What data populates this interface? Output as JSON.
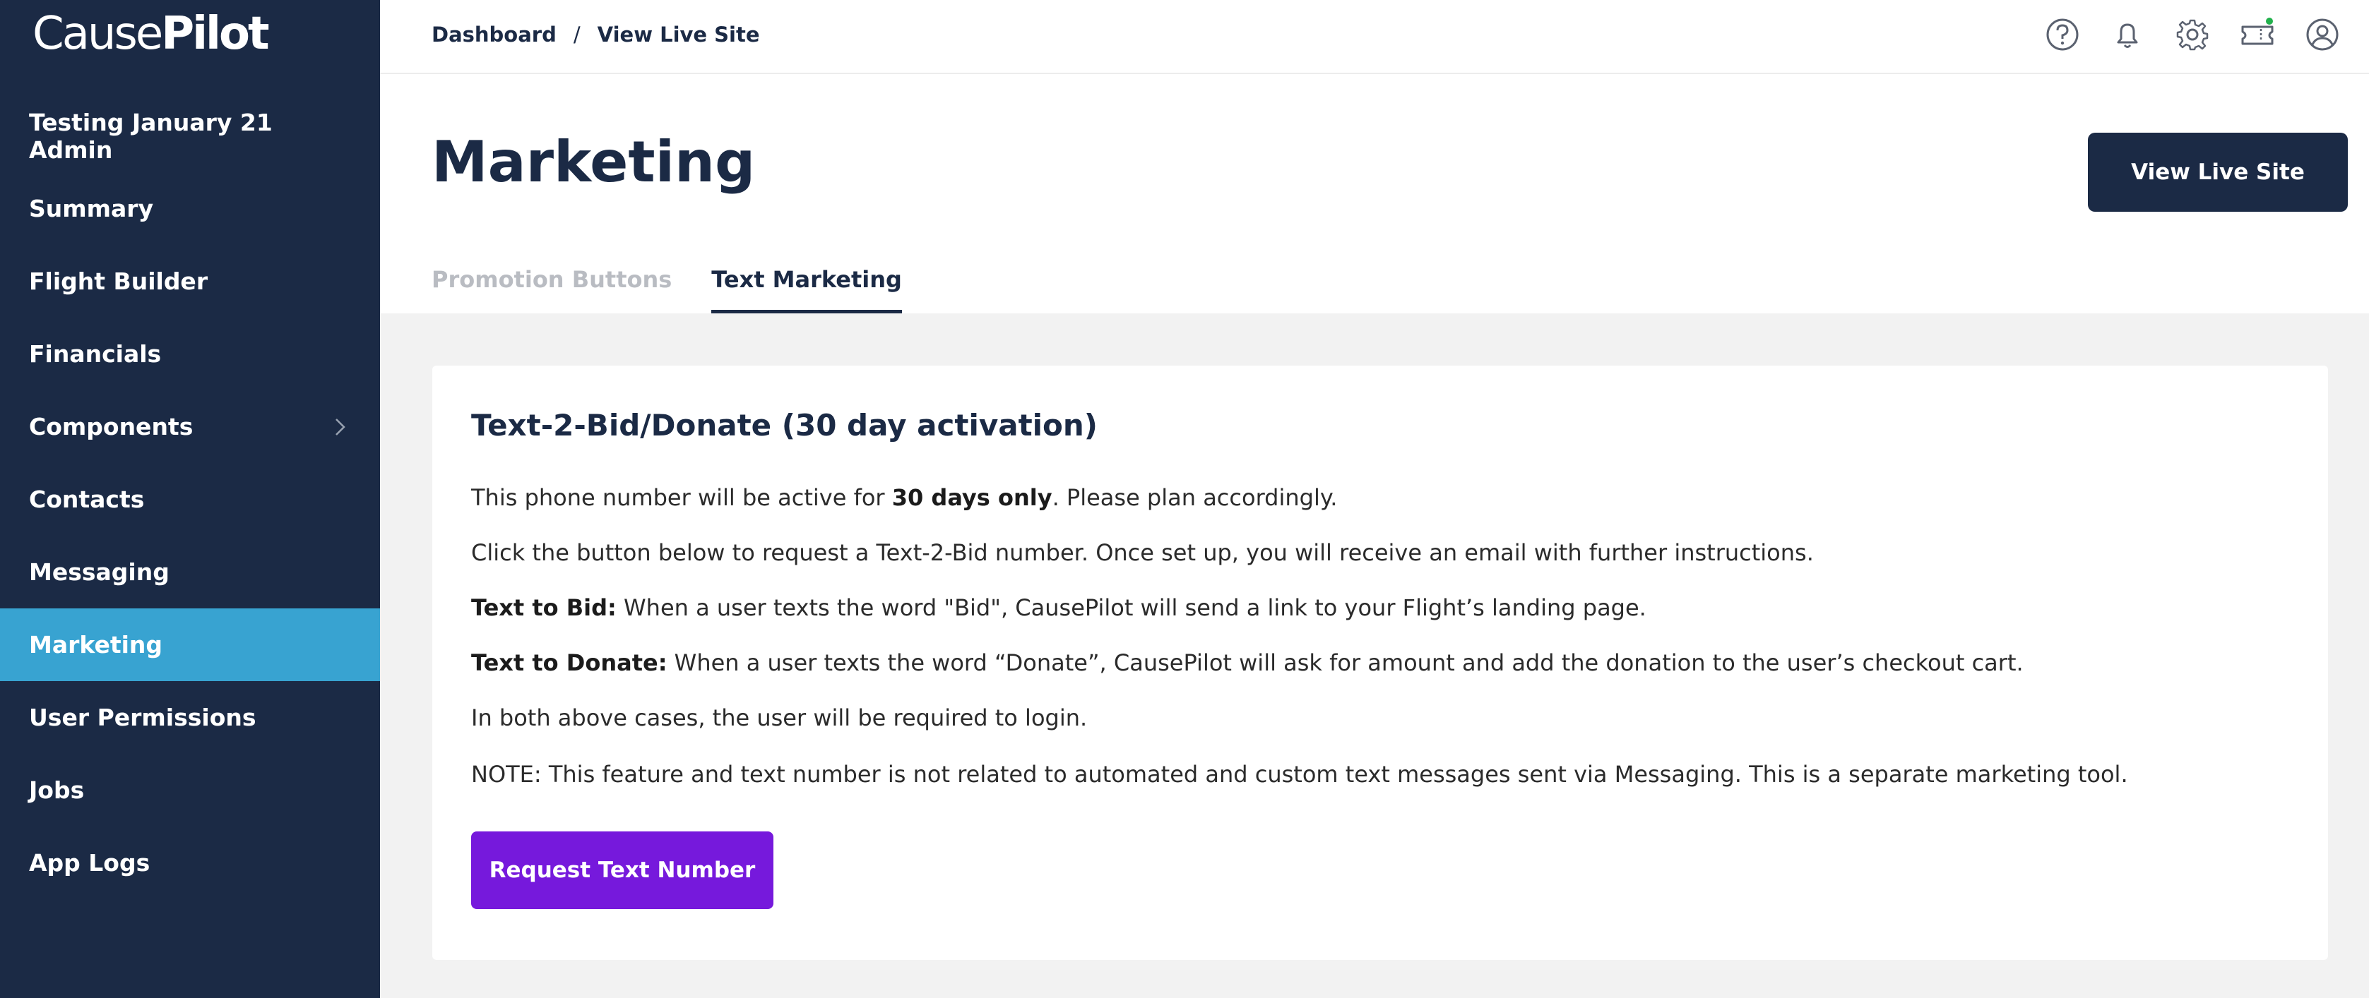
{
  "brand": {
    "logo_part1": "Cause",
    "logo_part2": "Pilot"
  },
  "sidebar": {
    "items": [
      {
        "label": "Testing January 21 Admin",
        "active": false
      },
      {
        "label": "Summary",
        "active": false
      },
      {
        "label": "Flight Builder",
        "active": false
      },
      {
        "label": "Financials",
        "active": false
      },
      {
        "label": "Components",
        "active": false,
        "has_submenu": true
      },
      {
        "label": "Contacts",
        "active": false
      },
      {
        "label": "Messaging",
        "active": false
      },
      {
        "label": "Marketing",
        "active": true
      },
      {
        "label": "User Permissions",
        "active": false
      },
      {
        "label": "Jobs",
        "active": false
      },
      {
        "label": "App Logs",
        "active": false
      }
    ]
  },
  "topbar": {
    "breadcrumb": [
      "Dashboard",
      "View Live Site"
    ],
    "breadcrumb_separator": "/",
    "icons": [
      "help-icon",
      "bell-icon",
      "gear-icon",
      "ticket-icon",
      "user-icon"
    ],
    "notification_dot_color": "#22b14c"
  },
  "header": {
    "title": "Marketing",
    "live_button": "View Live Site",
    "tabs": [
      {
        "label": "Promotion Buttons",
        "active": false
      },
      {
        "label": "Text Marketing",
        "active": true
      }
    ]
  },
  "card": {
    "title": "Text-2-Bid/Donate (30 day activation)",
    "p1_pre": "This phone number will be active for ",
    "p1_bold": "30 days only",
    "p1_post": ". Please plan accordingly.",
    "p2": "Click the button below to request a Text-2-Bid number. Once set up, you will receive an email with further instructions.",
    "p3_bold": "Text to Bid:",
    "p3_text": " When a user texts the word \"Bid\", CausePilot will send a link to your Flight’s landing page.",
    "p4_bold": "Text to Donate:",
    "p4_text": " When a user texts the word “Donate”, CausePilot will ask for amount and add the donation to the user’s checkout cart.",
    "p5": "In both above cases, the user will be required to login.",
    "p6": "NOTE: This feature and text number is not related to automated and custom text messages sent via Messaging. This is a separate marketing tool.",
    "button": "Request Text Number"
  },
  "colors": {
    "sidebar_bg": "#1b2a45",
    "active_nav": "#38a3d1",
    "primary_button": "#7619dc",
    "dark_button": "#1b2a45"
  }
}
